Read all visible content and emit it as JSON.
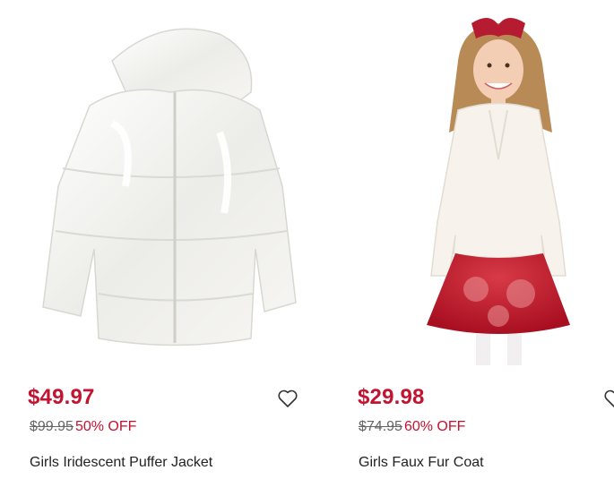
{
  "products": [
    {
      "image_label": "white iridescent puffer jacket",
      "price": "$49.97",
      "original_price": "$99.95",
      "discount": "50% OFF",
      "name": "Girls Iridescent Puffer Jacket",
      "favorite_icon": "heart-outline-icon"
    },
    {
      "image_label": "girl in white faux fur coat and red floral dress",
      "price": "$29.98",
      "original_price": "$74.95",
      "discount": "60% OFF",
      "name": "Girls Faux Fur Coat",
      "favorite_icon": "heart-outline-icon"
    }
  ],
  "colors": {
    "sale_price": "#c41230",
    "strikethrough": "#666666",
    "text": "#222222"
  }
}
